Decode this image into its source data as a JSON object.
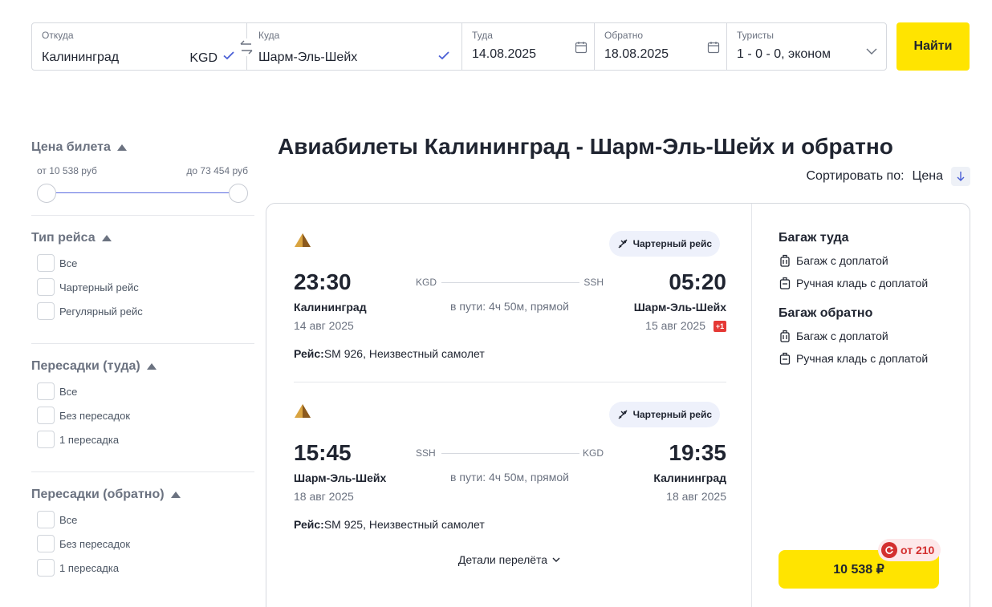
{
  "search": {
    "from_label": "Откуда",
    "from_value": "Калининград",
    "from_code": "KGD",
    "to_label": "Куда",
    "to_value": "Шарм-Эль-Шейх",
    "depart_label": "Туда",
    "depart_value": "14.08.2025",
    "return_label": "Обратно",
    "return_value": "18.08.2025",
    "tourists_label": "Туристы",
    "tourists_value": "1 - 0 - 0, эконом",
    "find_label": "Найти"
  },
  "filters": {
    "price": {
      "title": "Цена билета",
      "from": "от 10 538 руб",
      "to": "до 73 454 руб"
    },
    "flight_type": {
      "title": "Тип рейса",
      "options": [
        "Все",
        "Чартерный рейс",
        "Регулярный рейс"
      ]
    },
    "stops_out": {
      "title": "Пересадки (туда)",
      "options": [
        "Все",
        "Без пересадок",
        "1 пересадка"
      ]
    },
    "stops_back": {
      "title": "Пересадки (обратно)",
      "options": [
        "Все",
        "Без пересадок",
        "1 пересадка"
      ]
    }
  },
  "main": {
    "title": "Авиабилеты Калининград - Шарм-Эль-Шейх и обратно",
    "sort_label": "Сортировать по:",
    "sort_value": "Цена"
  },
  "card": {
    "segments": [
      {
        "charter": "Чартерный рейс",
        "dep_time": "23:30",
        "arr_time": "05:20",
        "dep_city": "Калининград",
        "arr_city": "Шарм-Эль-Шейх",
        "dep_date": "14 авг 2025",
        "arr_date": "15 авг 2025",
        "day_shift": "+1",
        "dep_code": "KGD",
        "arr_code": "SSH",
        "duration": "в пути: 4ч 50м, прямой",
        "flight_label": "Рейс:",
        "flight_value": "SM 926, Неизвестный самолет"
      },
      {
        "charter": "Чартерный рейс",
        "dep_time": "15:45",
        "arr_time": "19:35",
        "dep_city": "Шарм-Эль-Шейх",
        "arr_city": "Калининград",
        "dep_date": "18 авг 2025",
        "arr_date": "18 авг 2025",
        "dep_code": "SSH",
        "arr_code": "KGD",
        "duration": "в пути: 4ч 50м, прямой",
        "flight_label": "Рейс:",
        "flight_value": "SM 925, Неизвестный самолет"
      }
    ],
    "details": "Детали перелёта",
    "baggage_out_title": "Багаж туда",
    "baggage_out_items": [
      "Багаж с доплатой",
      "Ручная кладь с доплатой"
    ],
    "baggage_back_title": "Багаж обратно",
    "baggage_back_items": [
      "Багаж с доплатой",
      "Ручная кладь с доплатой"
    ],
    "cashback": "от 210",
    "price": "10 538 ₽"
  },
  "colors": {
    "accent_yellow": "#ffe400",
    "link_blue": "#5b6ce0",
    "badge_red": "#d32f2f"
  }
}
